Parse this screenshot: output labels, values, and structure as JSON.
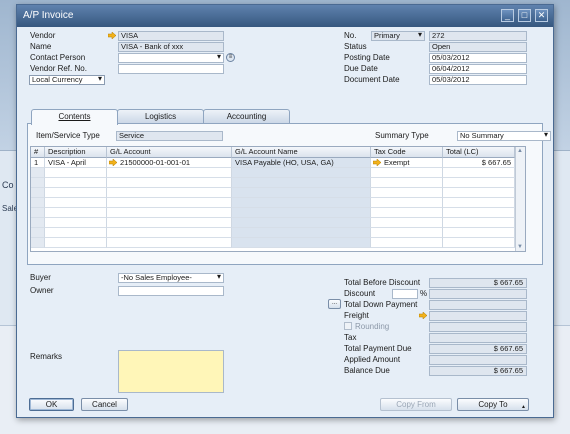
{
  "background": {
    "label_co": "Co",
    "label_sales": "Sales"
  },
  "window": {
    "title": "A/P Invoice",
    "btn_min": "_",
    "btn_max": "□",
    "btn_close": "✕"
  },
  "left": {
    "vendor_label": "Vendor",
    "vendor_value": "VISA",
    "name_label": "Name",
    "name_value": "VISA - Bank of xxx",
    "contact_label": "Contact Person",
    "contact_value": "",
    "vendor_ref_label": "Vendor Ref. No.",
    "vendor_ref_value": "",
    "currency_value": "Local Currency"
  },
  "right": {
    "no_label": "No.",
    "series_value": "Primary",
    "no_value": "272",
    "status_label": "Status",
    "status_value": "Open",
    "posting_label": "Posting Date",
    "posting_value": "05/03/2012",
    "due_label": "Due Date",
    "due_value": "06/04/2012",
    "docdate_label": "Document Date",
    "docdate_value": "05/03/2012"
  },
  "tabs": [
    "Contents",
    "Logistics",
    "Accounting"
  ],
  "contents": {
    "item_type_label": "Item/Service Type",
    "item_type_value": "Service",
    "summary_label": "Summary Type",
    "summary_value": "No Summary",
    "columns": [
      "#",
      "Description",
      "G/L Account",
      "G/L Account Name",
      "Tax Code",
      "Total (LC)"
    ],
    "rows": [
      {
        "num": "1",
        "description": "VISA - April",
        "gl_account": "21500000-01-001-01",
        "gl_name": "VISA Payable (HO, USA, GA)",
        "tax_code": "Exempt",
        "total": "$ 667.65"
      }
    ]
  },
  "lower_left": {
    "buyer_label": "Buyer",
    "buyer_value": "-No Sales Employee-",
    "owner_label": "Owner",
    "owner_value": "",
    "remarks_label": "Remarks",
    "remarks_value": ""
  },
  "totals": {
    "before_discount_label": "Total Before Discount",
    "before_discount_value": "$ 667.65",
    "discount_label": "Discount",
    "discount_pct": "%",
    "discount_value": "",
    "down_payment_btn": "...",
    "down_payment_label": "Total Down Payment",
    "down_payment_value": "",
    "freight_label": "Freight",
    "freight_value": "",
    "rounding_label": "Rounding",
    "rounding_value": "",
    "tax_label": "Tax",
    "tax_value": "",
    "payment_due_label": "Total Payment Due",
    "payment_due_value": "$ 667.65",
    "applied_label": "Applied Amount",
    "applied_value": "",
    "balance_label": "Balance Due",
    "balance_value": "$ 667.65"
  },
  "buttons": {
    "ok": "OK",
    "cancel": "Cancel",
    "copy_from": "Copy From",
    "copy_to": "Copy To"
  },
  "icons": {
    "link_arrow": "link-arrow-icon"
  },
  "colors": {
    "title_bar": "#36577f",
    "link_arrow": "#f2b21b",
    "remarks_bg": "#fff6b8"
  }
}
